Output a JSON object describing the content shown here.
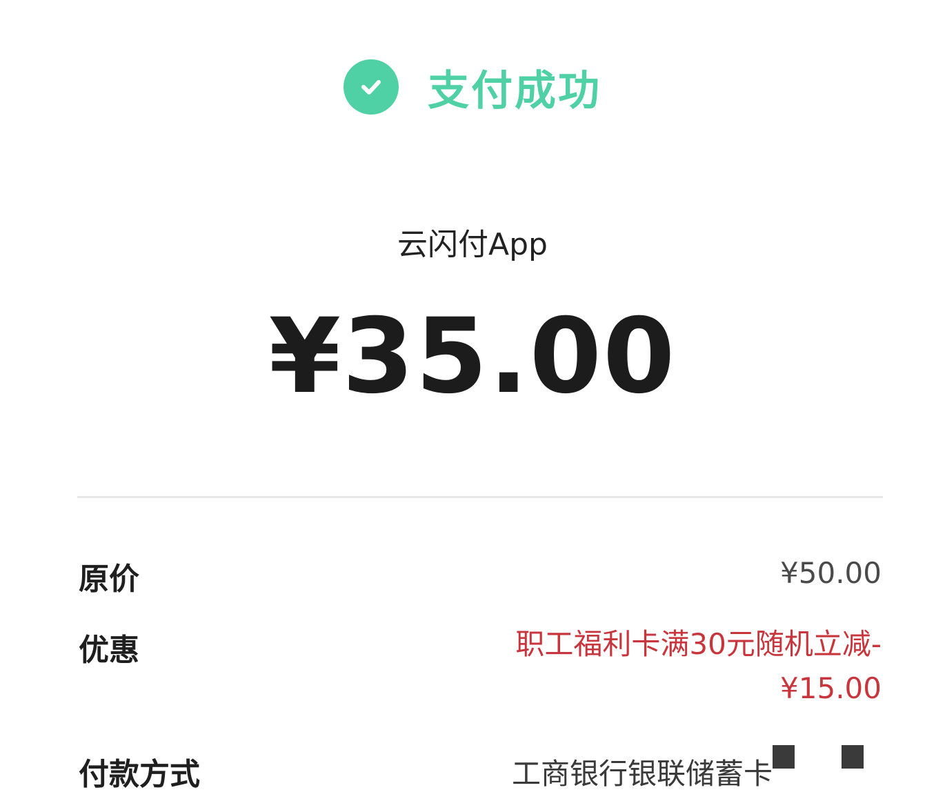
{
  "status": {
    "title": "支付成功",
    "icon": "check-circle-icon",
    "color": "#4fd1a5"
  },
  "merchant": {
    "name": "云闪付App"
  },
  "payment": {
    "amount": "¥35.00"
  },
  "details": {
    "original_price_label": "原价",
    "original_price_value": "¥50.00",
    "discount_label": "优惠",
    "discount_line1": "职工福利卡满30元随机立减-",
    "discount_line2": "¥15.00",
    "discount_color": "#c8363d",
    "payment_method_label": "付款方式",
    "payment_method_value": "工商银行银联储蓄卡"
  }
}
